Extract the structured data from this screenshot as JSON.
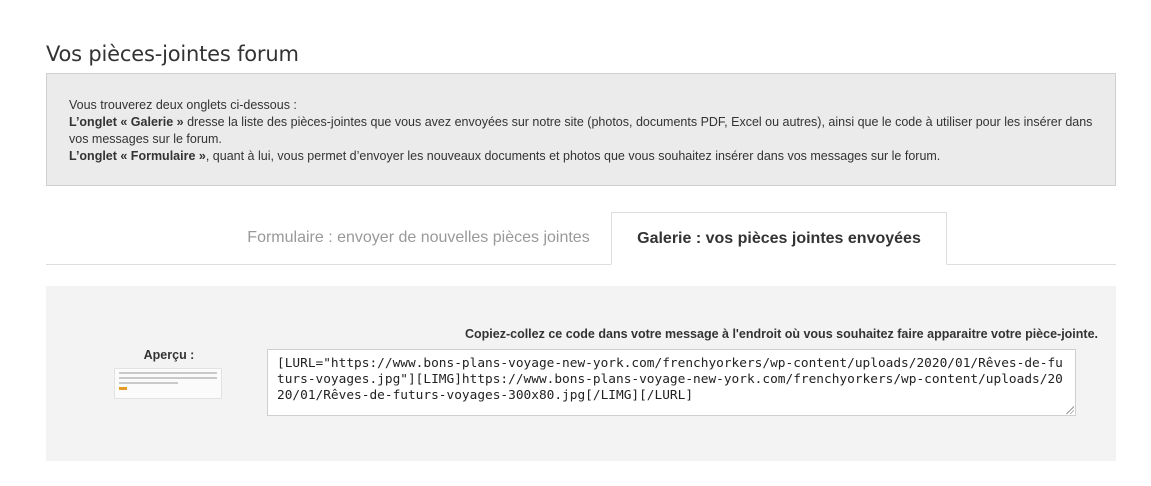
{
  "page": {
    "title": "Vos pièces-jointes forum"
  },
  "info": {
    "line1": "Vous trouverez deux onglets ci-dessous :",
    "gallery_strong": "L’onglet « Galerie »",
    "gallery_text": " dresse la liste des pièces-jointes que vous avez envoyées sur notre site (photos, documents PDF, Excel ou autres), ainsi que le code à utiliser pour les insérer dans vos messages sur le forum.",
    "form_strong": "L’onglet « Formulaire »",
    "form_text": ", quant à lui, vous permet d’envoyer les nouveaux documents et photos que vous souhaitez insérer dans vos messages sur le forum."
  },
  "tabs": {
    "form_label": "Formulaire : envoyer de nouvelles pièces jointes",
    "gallery_label": "Galerie : vos pièces jointes envoyées",
    "active": "gallery"
  },
  "gallery": {
    "preview_label": "Aperçu :",
    "copy_instruction": "Copiez-collez ce code dans votre message à l'endroit où vous souhaitez faire apparaitre votre pièce-jointe.",
    "code": "[LURL=\"https://www.bons-plans-voyage-new-york.com/frenchyorkers/wp-content/uploads/2020/01/Rêves-de-futurs-voyages.jpg\"][LIMG]https://www.bons-plans-voyage-new-york.com/frenchyorkers/wp-content/uploads/2020/01/Rêves-de-futurs-voyages-300x80.jpg[/LIMG][/LURL]"
  },
  "colors": {
    "panel_bg": "#f3f3f3",
    "info_bg": "#ebebeb",
    "inactive_tab": "#999999"
  }
}
